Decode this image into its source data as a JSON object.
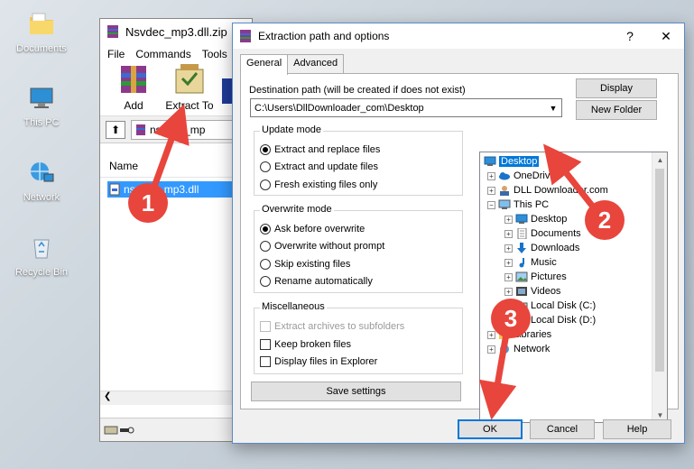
{
  "desktop": {
    "icons": [
      {
        "label": "Documents"
      },
      {
        "label": "This PC"
      },
      {
        "label": "Network"
      },
      {
        "label": "Recycle Bin"
      }
    ]
  },
  "winrar": {
    "title": "Nsvdec_mp3.dll.zip",
    "menu": [
      "File",
      "Commands",
      "Tools"
    ],
    "toolbar": {
      "add": "Add",
      "extract_to": "Extract To"
    },
    "path_text": "nsvdec_mp",
    "column_name": "Name",
    "file": "nsvdec_mp3.dll"
  },
  "dialog": {
    "title": "Extraction path and options",
    "help": "?",
    "close": "✕",
    "tabs": [
      "General",
      "Advanced"
    ],
    "dest_label": "Destination path (will be created if does not exist)",
    "dest_value": "C:\\Users\\DllDownloader_com\\Desktop",
    "buttons": {
      "display": "Display",
      "new_folder": "New Folder",
      "save_settings": "Save settings",
      "ok": "OK",
      "cancel": "Cancel",
      "help": "Help"
    },
    "update_mode": {
      "title": "Update mode",
      "options": [
        "Extract and replace files",
        "Extract and update files",
        "Fresh existing files only"
      ],
      "selected": 0
    },
    "overwrite_mode": {
      "title": "Overwrite mode",
      "options": [
        "Ask before overwrite",
        "Overwrite without prompt",
        "Skip existing files",
        "Rename automatically"
      ],
      "selected": 0
    },
    "misc": {
      "title": "Miscellaneous",
      "options": [
        "Extract archives to subfolders",
        "Keep broken files",
        "Display files in Explorer"
      ]
    },
    "tree": [
      {
        "label": "Desktop",
        "selected": true
      },
      {
        "label": "OneDrive"
      },
      {
        "label": "DLL Downloader.com"
      },
      {
        "label": "This PC"
      },
      {
        "label": "Desktop"
      },
      {
        "label": "Documents"
      },
      {
        "label": "Downloads"
      },
      {
        "label": "Music"
      },
      {
        "label": "Pictures"
      },
      {
        "label": "Videos"
      },
      {
        "label": "Local Disk (C:)"
      },
      {
        "label": "Local Disk (D:)"
      },
      {
        "label": "Libraries"
      },
      {
        "label": "Network"
      }
    ]
  },
  "annotations": {
    "badges": [
      "1",
      "2",
      "3"
    ],
    "color": "#e8453c"
  },
  "colors": {
    "accent": "#0078d7",
    "selection": "#3399ff",
    "badge": "#e8453c"
  }
}
